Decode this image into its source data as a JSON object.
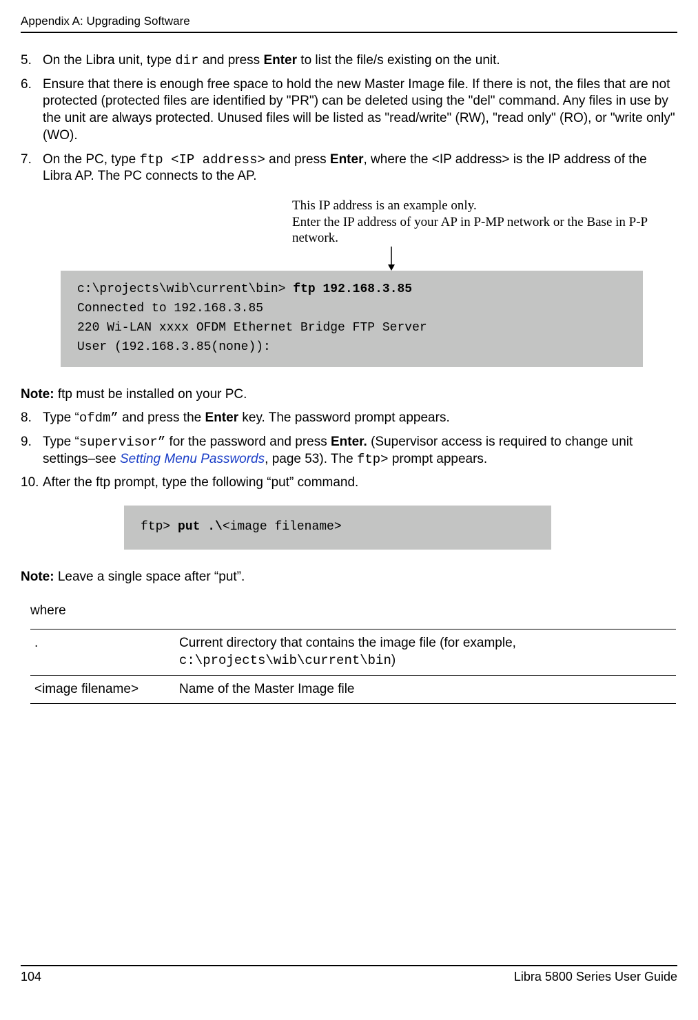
{
  "header": "Appendix A: Upgrading Software",
  "steps": {
    "s5": {
      "num": "5.",
      "pre": "On the Libra unit, type ",
      "code": "dir",
      "mid": " and press ",
      "bold": "Enter",
      "post": " to list the file/s existing on the unit."
    },
    "s6": {
      "num": "6.",
      "text": "Ensure that there is enough free space to hold the new Master Image file. If there is not, the files that are not protected (protected files are identified by \"PR\") can be deleted using the \"del\" command. Any files in use by the unit are always protected. Unused files will be listed as \"read/write\" (RW), \"read only\" (RO), or \"write only\" (WO)."
    },
    "s7": {
      "num": "7.",
      "pre": "On the PC, type ",
      "code": "ftp <IP address>",
      "mid": " and press ",
      "bold": "Enter",
      "post1": ", where the <IP address> is the IP address of the Libra AP. The PC connects to the AP."
    },
    "s8": {
      "num": "8.",
      "pre": "Type “",
      "code": "ofdm",
      "q2": "”",
      "mid": " and press the ",
      "bold": "Enter",
      "post": " key. The password prompt appears."
    },
    "s9": {
      "num": "9.",
      "pre": "Type “",
      "code": "supervisor",
      "q2": "”",
      "mid": " for the password and press ",
      "bold": "Enter. ",
      "post1": "(Supervisor access is required to change unit settings–see ",
      "link": "Setting Menu Passwords",
      "post2": ", page 53). The ",
      "code2": "ftp>",
      "post3": " prompt appears."
    },
    "s10": {
      "num": "10.",
      "text": "After the ftp prompt, type the following “put” command."
    }
  },
  "ip_note_line1": "This IP address is an example only.",
  "ip_note_line2": "Enter the IP address of your AP in P-MP network or the Base in P-P network.",
  "code1": {
    "line1a": "c:\\projects\\wib\\current\\bin> ",
    "line1b": "ftp 192.168.3.85",
    "line2": "Connected to 192.168.3.85",
    "line3": "220 Wi-LAN xxxx OFDM Ethernet Bridge FTP Server",
    "line4": "User (192.168.3.85(none)):"
  },
  "note1_label": "Note: ",
  "note1_text": "ftp must be installed on your PC.",
  "code2": {
    "pre": "ftp> ",
    "bold": "put .\\",
    "rest": "<image filename>"
  },
  "note2_label": "Note: ",
  "note2_text": "Leave a single space after “put”.",
  "where": {
    "label": "where",
    "row1": {
      "col1": ".",
      "col2a": "Current directory that contains the image file (for example, ",
      "col2b_code": "c:\\projects\\wib\\current\\bin",
      "col2c": ")"
    },
    "row2": {
      "col1": "<image filename>",
      "col2": "Name of the Master Image file"
    }
  },
  "footer": {
    "page": "104",
    "title": "Libra 5800 Series User Guide"
  }
}
